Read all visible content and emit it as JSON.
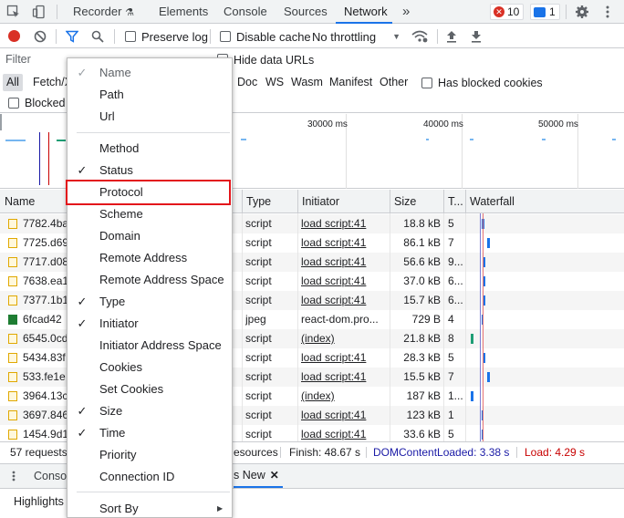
{
  "tabs": {
    "recorder": "Recorder",
    "elements": "Elements",
    "console": "Console",
    "sources": "Sources",
    "network": "Network",
    "overflow": "»",
    "errors": "10",
    "messages": "1"
  },
  "toolbar": {
    "preserve_log": "Preserve log",
    "disable_cache": "Disable cache",
    "throttling": "No throttling"
  },
  "filter": {
    "placeholder": "Filter",
    "invert_partial": "I",
    "hide_data_urls": "Hide data URLs",
    "types": {
      "all": "All",
      "fetch": "Fetch/X",
      "doc": "Doc",
      "ws": "WS",
      "wasm": "Wasm",
      "manifest": "Manifest",
      "other": "Other"
    },
    "has_blocked_cookies": "Has blocked cookies",
    "blocked": "Blocked"
  },
  "overview": {
    "ticks": [
      "30000 ms",
      "40000 ms",
      "50000 ms"
    ]
  },
  "table": {
    "headers": {
      "name": "Name",
      "type": "Type",
      "initiator": "Initiator",
      "size": "Size",
      "time": "T...",
      "waterfall": "Waterfall"
    },
    "rows": [
      {
        "name": "7782.4ba",
        "type": "script",
        "initiator": "load script:41",
        "size": "18.8 kB",
        "time": "5",
        "kind": "js"
      },
      {
        "name": "7725.d69",
        "type": "script",
        "initiator": "load script:41",
        "size": "86.1 kB",
        "time": "7",
        "kind": "js"
      },
      {
        "name": "7717.d08",
        "type": "script",
        "initiator": "load script:41",
        "size": "56.6 kB",
        "time": "9...",
        "kind": "js"
      },
      {
        "name": "7638.ea1",
        "type": "script",
        "initiator": "load script:41",
        "size": "37.0 kB",
        "time": "6...",
        "kind": "js"
      },
      {
        "name": "7377.1b1",
        "type": "script",
        "initiator": "load script:41",
        "size": "15.7 kB",
        "time": "6...",
        "kind": "js"
      },
      {
        "name": "6fcad42",
        "type": "jpeg",
        "initiator": "react-dom.pro...",
        "size": "729 B",
        "time": "4",
        "kind": "img"
      },
      {
        "name": "6545.0cd",
        "type": "script",
        "initiator": "(index)",
        "size": "21.8 kB",
        "time": "8",
        "kind": "js"
      },
      {
        "name": "5434.83f",
        "type": "script",
        "initiator": "load script:41",
        "size": "28.3 kB",
        "time": "5",
        "kind": "js"
      },
      {
        "name": "533.fe1e",
        "type": "script",
        "initiator": "load script:41",
        "size": "15.5 kB",
        "time": "7",
        "kind": "js"
      },
      {
        "name": "3964.13c",
        "type": "script",
        "initiator": "(index)",
        "size": "187 kB",
        "time": "1...",
        "kind": "js"
      },
      {
        "name": "3697.846",
        "type": "script",
        "initiator": "load script:41",
        "size": "123 kB",
        "time": "1",
        "kind": "js"
      },
      {
        "name": "1454.9d1",
        "type": "script",
        "initiator": "load script:41",
        "size": "33.6 kB",
        "time": "5",
        "kind": "js"
      }
    ]
  },
  "status": {
    "requests": "57 requests",
    "resources": "esources",
    "finish": "Finish: 48.67 s",
    "dcl": "DOMContentLoaded: 3.38 s",
    "load": "Load: 4.29 s"
  },
  "drawer": {
    "console_tab": "Conso",
    "whats_new_tab": "s New",
    "highlights": "Highlights"
  },
  "menu": {
    "items": [
      {
        "label": "Name",
        "checked": true,
        "disabled": true
      },
      {
        "label": "Path",
        "checked": false
      },
      {
        "label": "Url",
        "checked": false
      },
      {
        "label": "Method",
        "checked": false
      },
      {
        "label": "Status",
        "checked": true
      },
      {
        "label": "Protocol",
        "checked": false
      },
      {
        "label": "Scheme",
        "checked": false
      },
      {
        "label": "Domain",
        "checked": false
      },
      {
        "label": "Remote Address",
        "checked": false
      },
      {
        "label": "Remote Address Space",
        "checked": false
      },
      {
        "label": "Type",
        "checked": true
      },
      {
        "label": "Initiator",
        "checked": true
      },
      {
        "label": "Initiator Address Space",
        "checked": false
      },
      {
        "label": "Cookies",
        "checked": false
      },
      {
        "label": "Set Cookies",
        "checked": false
      },
      {
        "label": "Size",
        "checked": true
      },
      {
        "label": "Time",
        "checked": true
      },
      {
        "label": "Priority",
        "checked": false
      },
      {
        "label": "Connection ID",
        "checked": false
      },
      {
        "label": "Sort By",
        "checked": false,
        "submenu": true
      }
    ],
    "check_glyph": "✓",
    "submenu_glyph": "▶"
  },
  "colors": {
    "accent": "#1a73e8",
    "error": "#d93025",
    "highlight_box": "#e3151b",
    "dcl": "#1a1aa6",
    "load": "#c80000"
  }
}
